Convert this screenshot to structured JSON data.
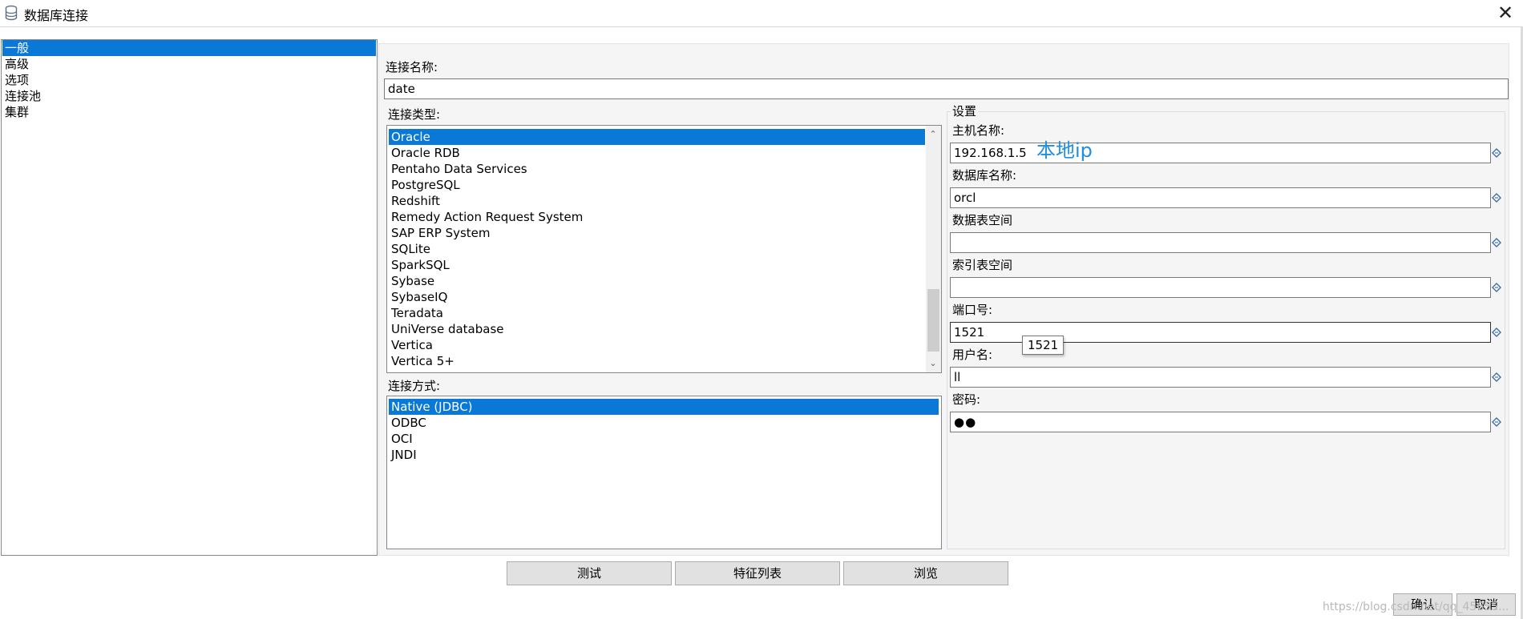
{
  "window": {
    "title": "数据库连接",
    "close_glyph": "✕",
    "app_icon": "database-icon"
  },
  "nav": {
    "items": [
      {
        "label": "一般",
        "selected": true
      },
      {
        "label": "高级"
      },
      {
        "label": "选项"
      },
      {
        "label": "连接池"
      },
      {
        "label": "集群"
      }
    ]
  },
  "connection_name": {
    "label": "连接名称:",
    "value": "date"
  },
  "connection_type": {
    "label": "连接类型:",
    "items": [
      "Oracle",
      "Oracle RDB",
      "Pentaho Data Services",
      "PostgreSQL",
      "Redshift",
      "Remedy Action Request System",
      "SAP ERP System",
      "SQLite",
      "SparkSQL",
      "Sybase",
      "SybaseIQ",
      "Teradata",
      "UniVerse database",
      "Vertica",
      "Vertica 5+"
    ],
    "selected": "Oracle",
    "scroll_up_glyph": "⌃",
    "scroll_down_glyph": "⌄"
  },
  "access_method": {
    "label": "连接方式:",
    "items": [
      "Native (JDBC)",
      "ODBC",
      "OCI",
      "JNDI"
    ],
    "selected": "Native (JDBC)"
  },
  "settings": {
    "title": "设置",
    "hostname": {
      "label": "主机名称:",
      "value": "192.168.1.5"
    },
    "database": {
      "label": "数据库名称:",
      "value": "orcl"
    },
    "data_tablespace": {
      "label": "数据表空间",
      "value": ""
    },
    "index_tablespace": {
      "label": "索引表空间",
      "value": ""
    },
    "port": {
      "label": "端口号:",
      "value": "1521",
      "tooltip": "1521"
    },
    "username": {
      "label": "用户名:",
      "value": "ll"
    },
    "password": {
      "label": "密码:",
      "value": "●●"
    },
    "variable_icon": "variable-diamond-icon"
  },
  "annotation": {
    "text": "本地ip",
    "color": "#1e8fe1"
  },
  "buttons": {
    "test": "测试",
    "features": "特征列表",
    "explore": "浏览",
    "ok": "确认",
    "cancel": "取消"
  },
  "watermark": "https://blog.csdn.net/qq_45655...",
  "colors": {
    "selection": "#0a78d7",
    "panel_bg": "#f5f5f5",
    "button_bg": "#e1e1e1"
  }
}
